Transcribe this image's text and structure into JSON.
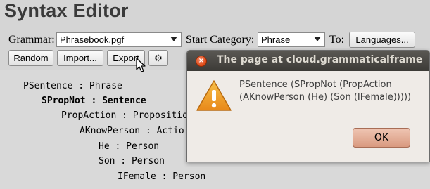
{
  "page_title": "Syntax Editor",
  "grammar": {
    "label": "Grammar:",
    "selected": "Phrasebook.pgf"
  },
  "start_category": {
    "label": "Start Category:",
    "selected": "Phrase"
  },
  "to": {
    "label": "To:",
    "button": "Languages..."
  },
  "actions": {
    "random": "Random",
    "import": "Import...",
    "export": "Export",
    "settings_icon": "⚙"
  },
  "tree": [
    "PSentence : Phrase",
    "SPropNot : Sentence",
    "PropAction : Propositio",
    "AKnowPerson : Actio",
    "He : Person",
    "Son : Person",
    "IFemale : Person"
  ],
  "dialog": {
    "title": "The page at cloud.grammaticalframe",
    "message": "PSentence (SPropNot (PropAction (AKnowPerson (He) (Son (IFemale)))))",
    "ok": "OK",
    "close_glyph": "×"
  },
  "icons": {
    "warning": "warning-icon",
    "close": "close-icon",
    "settings": "gear-icon",
    "cursor": "mouse-pointer-icon"
  },
  "colors": {
    "dialog_titlebar": "#3c3b37",
    "close_button": "#dd4814",
    "warning_fill": "#f0a020",
    "ok_button": "#d99a80"
  }
}
